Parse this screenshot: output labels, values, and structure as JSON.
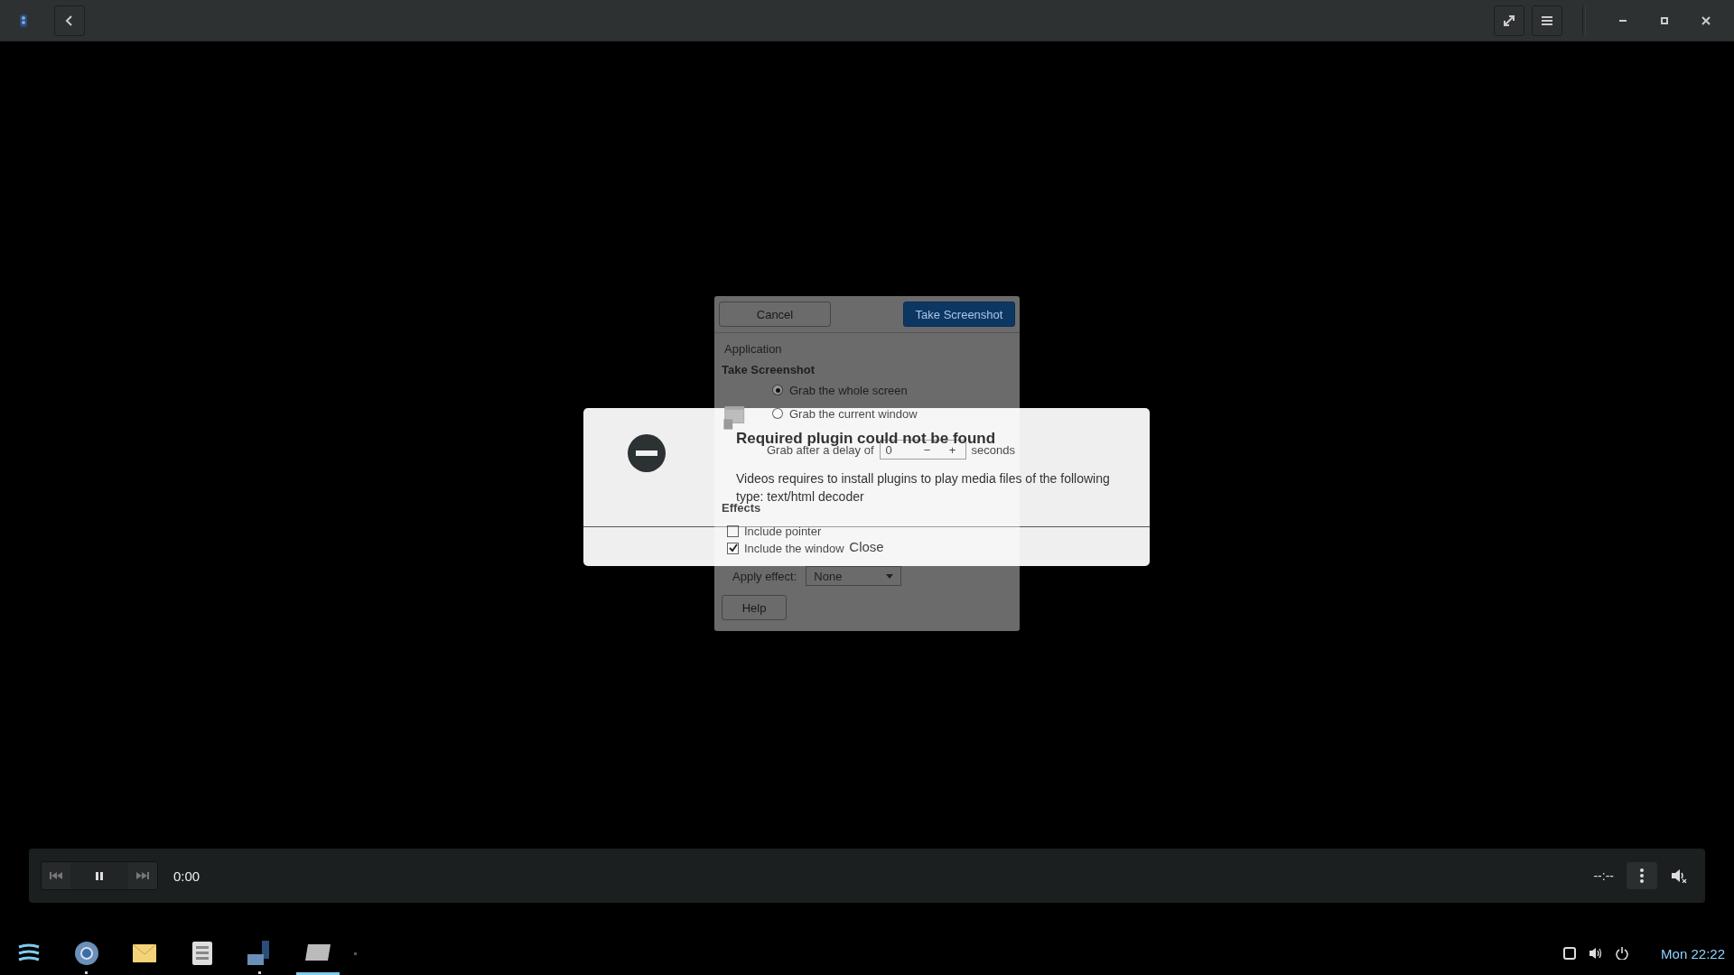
{
  "titlebar": {
    "buttons": [
      {
        "kind": "fullscreen"
      },
      {
        "kind": "menu"
      }
    ],
    "window_controls": [
      {
        "kind": "minimize"
      },
      {
        "kind": "maximize"
      },
      {
        "kind": "close"
      }
    ]
  },
  "screenshot_dialog": {
    "cancel": "Cancel",
    "take": "Take Screenshot",
    "header": "Application",
    "section": "Take Screenshot",
    "options": [
      {
        "label": "Grab the whole screen",
        "selected": true
      },
      {
        "label": "Grab the current window",
        "selected": false
      }
    ],
    "delay_label": "Grab after a delay of",
    "delay_value": "0",
    "minus": "−",
    "plus": "+",
    "delay_unit": "seconds",
    "effects_title": "Effects",
    "effects": [
      {
        "label": "Include pointer",
        "checked": false
      },
      {
        "label": "Include the window",
        "checked": true
      }
    ],
    "apply_label": "Apply effect:",
    "apply_value": "None",
    "help": "Help"
  },
  "error_dialog": {
    "title": "Required plugin could not be found",
    "message": "Videos requires to install plugins to play media files of the following type: text/html decoder",
    "button": "Close"
  },
  "player": {
    "playing": true,
    "position": "0:00",
    "duration": "--:--"
  },
  "taskbar": {
    "items": [
      {
        "kind": "launcher",
        "running": false,
        "selected": false
      },
      {
        "kind": "browser",
        "running": true,
        "selected": false
      },
      {
        "kind": "mail",
        "running": false,
        "selected": false
      },
      {
        "kind": "files",
        "running": false,
        "selected": false
      },
      {
        "kind": "screenshot",
        "running": true,
        "selected": false
      },
      {
        "kind": "videos",
        "running": false,
        "selected": true
      }
    ],
    "tray": [
      {
        "kind": "display"
      },
      {
        "kind": "volume"
      },
      {
        "kind": "power"
      }
    ],
    "clock": "Mon 22:22"
  }
}
